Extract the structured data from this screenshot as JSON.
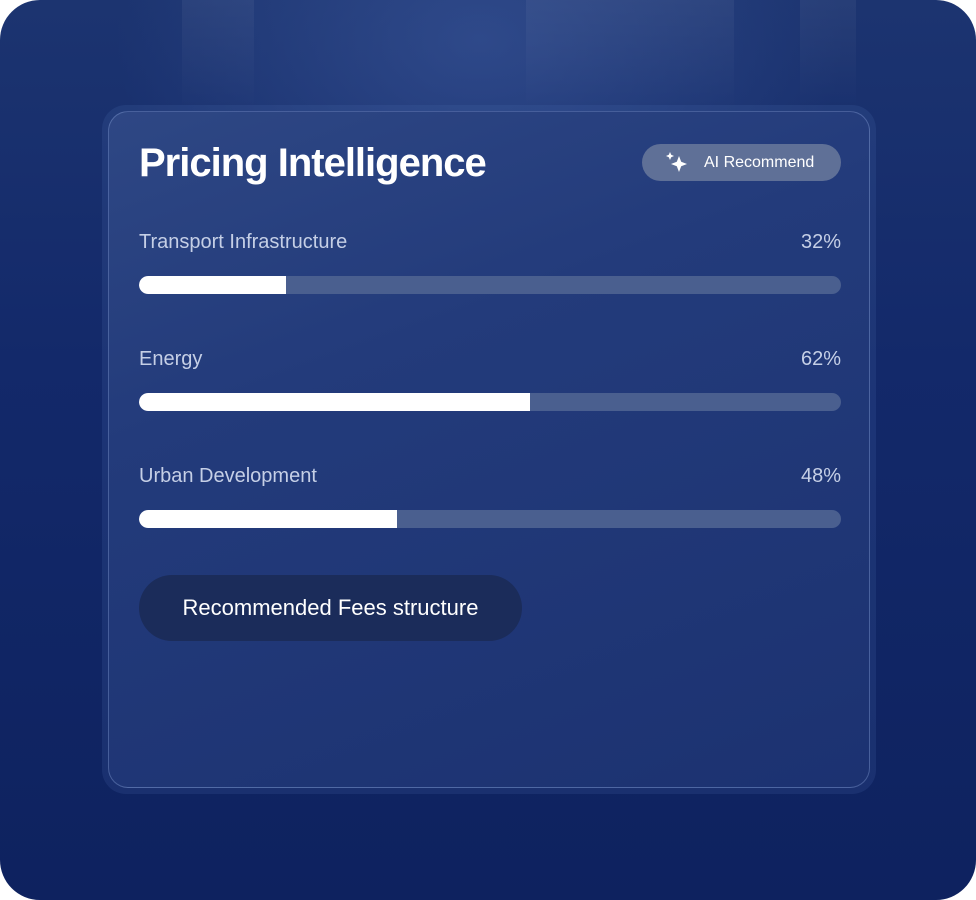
{
  "card": {
    "title": "Pricing Intelligence",
    "ai_button": {
      "label": "AI Recommend",
      "icon": "sparkles-icon"
    },
    "metrics": [
      {
        "label": "Transport Infrastructure",
        "value_text": "32%",
        "fill_fraction": 0.21
      },
      {
        "label": "Energy",
        "value_text": "62%",
        "fill_fraction": 0.557
      },
      {
        "label": "Urban Development",
        "value_text": "48%",
        "fill_fraction": 0.368
      }
    ],
    "fees_button": {
      "label": "Recommended Fees structure"
    }
  },
  "colors": {
    "background": "#13296a",
    "card": "#233b7b",
    "bar_track": "#4a5f8f",
    "bar_fill": "#ffffff",
    "ai_button": "#5f7097",
    "fees_button": "#1b2c5a"
  }
}
